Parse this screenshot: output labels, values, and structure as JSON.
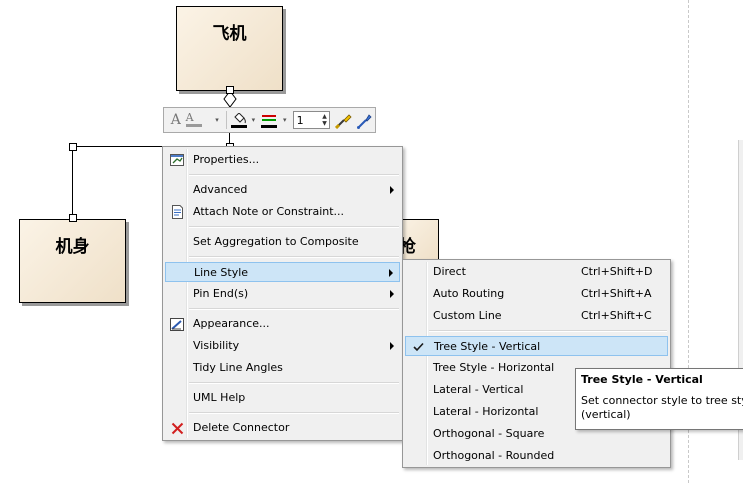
{
  "diagram": {
    "top_class": "飞机",
    "left_class": "机身",
    "right_class_partial": "枪"
  },
  "toolbar": {
    "font_icon": "font-icon",
    "line_width_value": "1"
  },
  "context_menu": {
    "items": [
      {
        "label": "Properties...",
        "icon": "properties-icon"
      },
      {
        "label": "Advanced",
        "submenu": true
      },
      {
        "label": "Attach Note or Constraint...",
        "icon": "note-icon"
      },
      {
        "label": "Set Aggregation to Composite"
      },
      {
        "label": "Line Style",
        "submenu": true,
        "highlighted": true
      },
      {
        "label": "Pin End(s)",
        "submenu": true
      },
      {
        "label": "Appearance...",
        "icon": "appearance-icon"
      },
      {
        "label": "Visibility",
        "submenu": true
      },
      {
        "label": "Tidy Line Angles"
      },
      {
        "label": "UML Help"
      },
      {
        "label": "Delete Connector",
        "icon": "delete-icon"
      }
    ]
  },
  "line_style_menu": {
    "items": [
      {
        "label": "Direct",
        "shortcut": "Ctrl+Shift+D"
      },
      {
        "label": "Auto Routing",
        "shortcut": "Ctrl+Shift+A"
      },
      {
        "label": "Custom Line",
        "shortcut": "Ctrl+Shift+C"
      },
      {
        "label": "Tree Style - Vertical",
        "checked": true,
        "highlighted": true
      },
      {
        "label": "Tree Style - Horizontal"
      },
      {
        "label": "Lateral - Vertical"
      },
      {
        "label": "Lateral - Horizontal"
      },
      {
        "label": "Orthogonal - Square"
      },
      {
        "label": "Orthogonal - Rounded"
      }
    ]
  },
  "tooltip": {
    "title": "Tree Style - Vertical",
    "body": "Set connector style to tree style (vertical)"
  },
  "colors": {
    "highlight_bg": "#cde5f7",
    "highlight_border": "#8ec2ee",
    "class_fill": "#f3e7d3",
    "delete_red": "#d21f1f"
  }
}
